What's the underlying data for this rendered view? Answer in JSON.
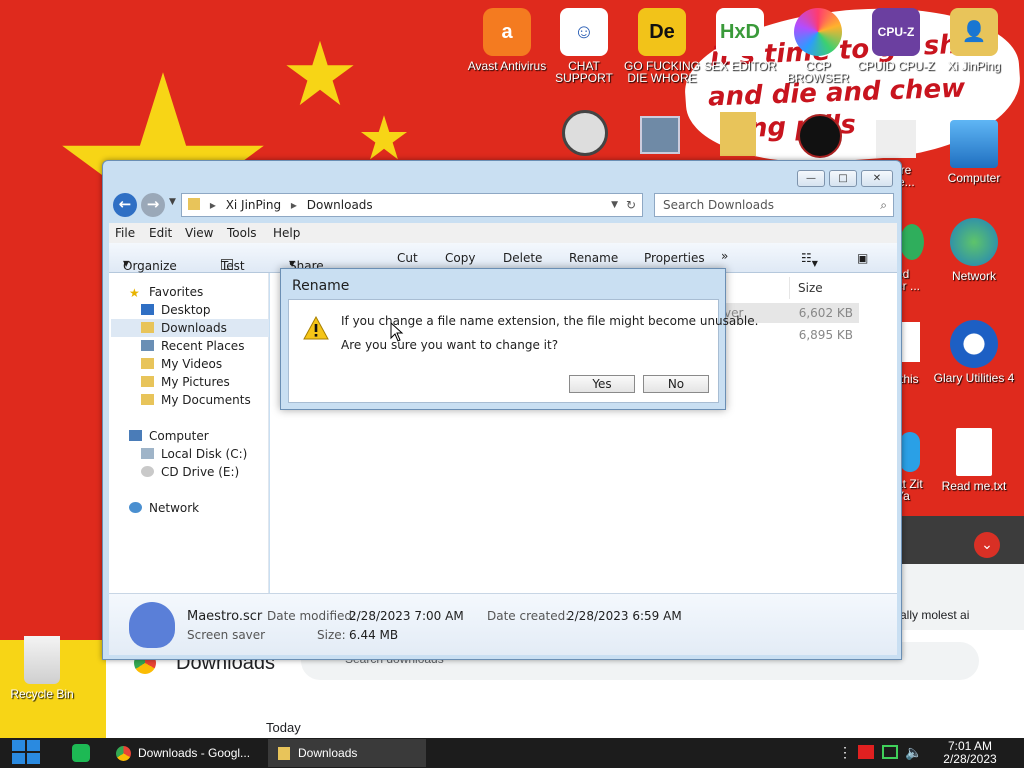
{
  "desktop": {
    "icons_top": [
      {
        "label": "Avast Antivirus",
        "icon": "avast-icon",
        "color": "#f47b20"
      },
      {
        "label": "CHAT SUPPORT",
        "icon": "doctor-icon",
        "color": "#ffffff"
      },
      {
        "label": "GO FUCKING DIE WHORE",
        "icon": "de-logo-icon",
        "color": "#f2c319"
      },
      {
        "label": "SEX EDITOR",
        "icon": "hxd-icon",
        "color": "#ffffff"
      },
      {
        "label": "CCP BROWSER",
        "icon": "browser-icon",
        "color": "#ff6f3c"
      },
      {
        "label": "CPUID CPU-Z",
        "icon": "cpuz-icon",
        "color": "#6b3fa0"
      },
      {
        "label": "Xi JinPing",
        "icon": "user-folder-icon",
        "color": "#e8c45a"
      }
    ],
    "icons_right": [
      {
        "label": "Computer",
        "icon": "computer-icon"
      },
      {
        "label": "Network",
        "icon": "network-icon"
      },
      {
        "label": "Glary Utilities 4",
        "icon": "glary-icon"
      },
      {
        "label": "Read me.txt",
        "icon": "text-file-icon"
      }
    ],
    "partial_labels": [
      "vare",
      "pte...",
      "ed",
      "er ...",
      "this",
      "at Zit",
      "Ya"
    ],
    "recycle_bin": "Recycle Bin",
    "graffiti_line1": "it's time to go shi",
    "graffiti_line2": "and die and chew",
    "graffiti_line3": "ing pills"
  },
  "chrome_bg": {
    "title": "Downloads",
    "search_placeholder": "Search downloads",
    "today": "Today",
    "right_text": "ally molest ai"
  },
  "explorer": {
    "window_buttons": {
      "minimize": "—",
      "maximize": "□",
      "close": "✕"
    },
    "address": {
      "root": "Xi JinPing",
      "folder": "Downloads"
    },
    "search_placeholder": "Search Downloads",
    "menu": [
      "File",
      "Edit",
      "View",
      "Tools",
      "Help"
    ],
    "commands": [
      "Organize",
      "Test",
      "Share with",
      "Cut",
      "Copy",
      "Delete",
      "Rename",
      "Properties",
      "»"
    ],
    "navpane": {
      "favorites": "Favorites",
      "desktop": "Desktop",
      "downloads": "Downloads",
      "recent": "Recent Places",
      "videos": "My Videos",
      "pictures": "My Pictures",
      "documents": "My Documents",
      "computer": "Computer",
      "local_disk": "Local Disk (C:)",
      "cd_drive": "CD Drive (E:)",
      "network": "Network"
    },
    "columns": {
      "size": "Size"
    },
    "rows": [
      {
        "type_partial": "ver",
        "size": "6,602 KB"
      },
      {
        "type_partial": "",
        "size": "6,895 KB"
      }
    ],
    "details": {
      "filename": "Maestro.scr",
      "filetype": "Screen saver",
      "modified_label": "Date modified:",
      "modified_value": "2/28/2023 7:00 AM",
      "created_label": "Date created:",
      "created_value": "2/28/2023 6:59 AM",
      "size_label": "Size:",
      "size_value": "6.44 MB"
    }
  },
  "dialog": {
    "title": "Rename",
    "line1": "If you change a file name extension, the file might become unusable.",
    "line2": "Are you sure you want to change it?",
    "yes": "Yes",
    "no": "No"
  },
  "taskbar": {
    "tasks": [
      {
        "label": "Downloads - Googl...",
        "icon": "chrome-icon"
      },
      {
        "label": "Downloads",
        "icon": "folder-icon"
      }
    ],
    "time": "7:01 AM",
    "date": "2/28/2023"
  }
}
